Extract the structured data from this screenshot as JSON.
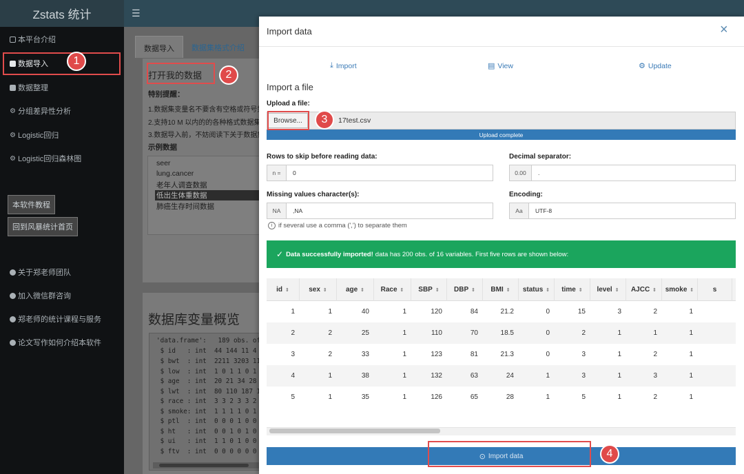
{
  "app": {
    "brand": "Zstats 统计",
    "menu_icon": "hamburger-icon"
  },
  "sidebar": {
    "items": [
      {
        "label": "本平台介绍",
        "icon": "square-icon"
      },
      {
        "label": "数据导入",
        "icon": "database-icon"
      },
      {
        "label": "数据整理",
        "icon": "database-icon"
      },
      {
        "label": "分组差异性分析",
        "icon": "gear-icon"
      },
      {
        "label": "Logistic回归",
        "icon": "gear-icon"
      },
      {
        "label": "Logistic回归森林图",
        "icon": "gear-icon"
      }
    ],
    "buttons": [
      "本软件教程",
      "回到风暴统计首页"
    ],
    "links": [
      {
        "label": "关于郑老师团队",
        "icon": "info-icon"
      },
      {
        "label": "加入微信群咨询",
        "icon": "info-icon"
      },
      {
        "label": "郑老师的统计课程与服务",
        "icon": "info-icon"
      },
      {
        "label": "论文写作如何介绍本软件",
        "icon": "info-icon"
      }
    ]
  },
  "tabs": [
    "数据导入",
    "数据集格式介绍"
  ],
  "page": {
    "open_data": "打开我的数据",
    "notice_title": "特别提醒：",
    "notices": [
      "1.数据集变量名不要含有空格或符号如",
      "2.支持10 M 以内的的各种格式数据集",
      "3.数据导入前，不妨阅读下关于数据集"
    ],
    "sample_title": "示例数据",
    "samples": [
      "seer",
      "lung.cancer",
      "老年人调查数据",
      "低出生体重数据",
      "肺癌生存时间数据"
    ],
    "db_title": "数据库变量概览",
    "code_lines": [
      "'data.frame':   189 obs. of",
      " $ id   : int  44 144 11 4",
      " $ bwt  : int  2211 3203 11",
      " $ low  : int  1 0 1 1 0 1",
      " $ age  : int  20 21 34 28",
      " $ lwt  : int  80 110 187 1",
      " $ race : int  3 3 2 3 3 2",
      " $ smoke: int  1 1 1 1 0 1",
      " $ ptl  : int  0 0 0 1 0 0",
      " $ ht   : int  0 0 1 0 1 0",
      " $ ui   : int  1 1 0 1 0 0",
      " $ ftv  : int  0 0 0 0 0 0"
    ]
  },
  "modal": {
    "title": "Import data",
    "close": "×",
    "top_links": [
      {
        "label": "Import",
        "icon": "download-icon"
      },
      {
        "label": "View",
        "icon": "table-icon"
      },
      {
        "label": "Update",
        "icon": "gear-icon"
      }
    ],
    "heading": "Import a file",
    "upload_label": "Upload a file:",
    "browse": "Browse...",
    "file_name": "17test.csv",
    "upload_status": "Upload complete",
    "upload_progress": 1.0,
    "rows_skip_label": "Rows to skip before reading data:",
    "rows_skip_addon": "n =",
    "rows_skip_value": "0",
    "decimal_label": "Decimal separator:",
    "decimal_addon": "0.00",
    "decimal_value": ".",
    "missing_label": "Missing values character(s):",
    "missing_addon": "NA",
    "missing_value": ",NA",
    "encoding_label": "Encoding:",
    "encoding_addon": "Aa",
    "encoding_value": "UTF-8",
    "hint": "if several use a comma (',') to separate them",
    "success_bold": "Data successfully imported!",
    "success_rest": "data has 200 obs. of 16 variables. First five rows are shown below:",
    "success_color": "#1ba55d",
    "import_button": "Import data"
  },
  "table": {
    "columns": [
      "id",
      "sex",
      "age",
      "Race",
      "SBP",
      "DBP",
      "BMI",
      "status",
      "time",
      "level",
      "AJCC",
      "smoke",
      "s"
    ],
    "rows": [
      [
        "1",
        "1",
        "40",
        "1",
        "120",
        "84",
        "21.2",
        "0",
        "15",
        "3",
        "2",
        "1",
        ""
      ],
      [
        "2",
        "2",
        "25",
        "1",
        "110",
        "70",
        "18.5",
        "0",
        "2",
        "1",
        "1",
        "1",
        ""
      ],
      [
        "3",
        "2",
        "33",
        "1",
        "123",
        "81",
        "21.3",
        "0",
        "3",
        "1",
        "2",
        "1",
        ""
      ],
      [
        "4",
        "1",
        "38",
        "1",
        "132",
        "63",
        "24",
        "1",
        "3",
        "1",
        "3",
        "1",
        ""
      ],
      [
        "5",
        "1",
        "35",
        "1",
        "126",
        "65",
        "28",
        "1",
        "5",
        "1",
        "2",
        "1",
        ""
      ]
    ]
  },
  "annotations": [
    "1",
    "2",
    "3",
    "4"
  ],
  "colors": {
    "accent": "#337ab7",
    "annotation": "#e14c4c",
    "success": "#1ba55d"
  }
}
